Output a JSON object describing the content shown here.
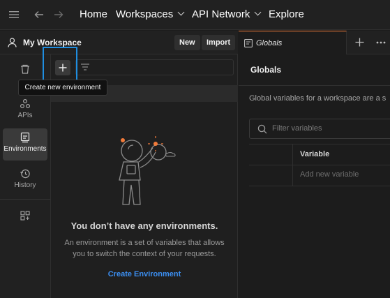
{
  "topbar": {
    "nav": [
      {
        "label": "Home"
      },
      {
        "label": "Workspaces"
      },
      {
        "label": "API Network"
      },
      {
        "label": "Explore"
      }
    ]
  },
  "workspace": {
    "title": "My Workspace",
    "new_label": "New",
    "import_label": "Import"
  },
  "rail": {
    "items": [
      {
        "label": "Collections"
      },
      {
        "label": "APIs"
      },
      {
        "label": "Environments"
      },
      {
        "label": "History"
      }
    ]
  },
  "env_panel": {
    "tooltip": "Create new environment",
    "empty_title": "You don’t have any environments.",
    "empty_desc": "An environment is a set of variables that allows you to switch the context of your requests.",
    "create_link": "Create Environment"
  },
  "right_pane": {
    "tab_label": "Globals",
    "title": "Globals",
    "desc": "Global variables for a workspace are a s",
    "search_placeholder": "Filter variables",
    "column_header": "Variable",
    "add_placeholder": "Add new variable"
  },
  "colors": {
    "accent_blue": "#1f8ee0",
    "link_blue": "#3b8ef0",
    "tab_accent": "#f27b3a"
  }
}
